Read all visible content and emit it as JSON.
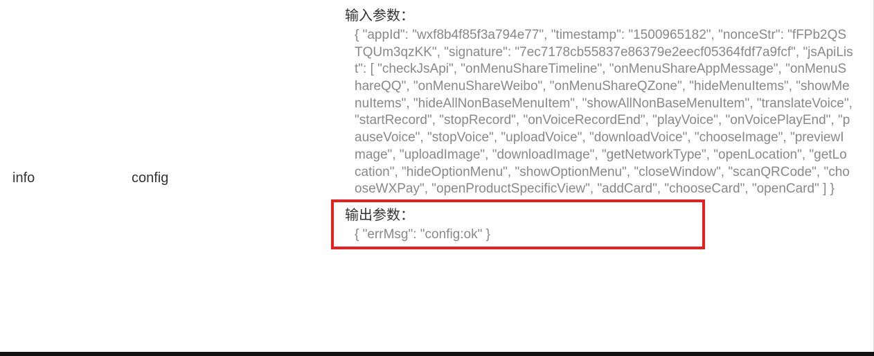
{
  "row": {
    "level": "info",
    "method": "config"
  },
  "input": {
    "heading": "输入参数：",
    "body": "{ \"appId\": \"wxf8b4f85f3a794e77\", \"timestamp\": \"1500965182\", \"nonceStr\": \"fFPb2QSTQUm3qzKK\", \"signature\": \"7ec7178cb55837e86379e2eecf05364fdf7a9fcf\", \"jsApiList\": [ \"checkJsApi\", \"onMenuShareTimeline\", \"onMenuShareAppMessage\", \"onMenuShareQQ\", \"onMenuShareWeibo\", \"onMenuShareQZone\", \"hideMenuItems\", \"showMenuItems\", \"hideAllNonBaseMenuItem\", \"showAllNonBaseMenuItem\", \"translateVoice\", \"startRecord\", \"stopRecord\", \"onVoiceRecordEnd\", \"playVoice\", \"onVoicePlayEnd\", \"pauseVoice\", \"stopVoice\", \"uploadVoice\", \"downloadVoice\", \"chooseImage\", \"previewImage\", \"uploadImage\", \"downloadImage\", \"getNetworkType\", \"openLocation\", \"getLocation\", \"hideOptionMenu\", \"showOptionMenu\", \"closeWindow\", \"scanQRCode\", \"chooseWXPay\", \"openProductSpecificView\", \"addCard\", \"chooseCard\", \"openCard\" ] }"
  },
  "output": {
    "heading": "输出参数：",
    "body": "{ \"errMsg\": \"config:ok\" }"
  }
}
